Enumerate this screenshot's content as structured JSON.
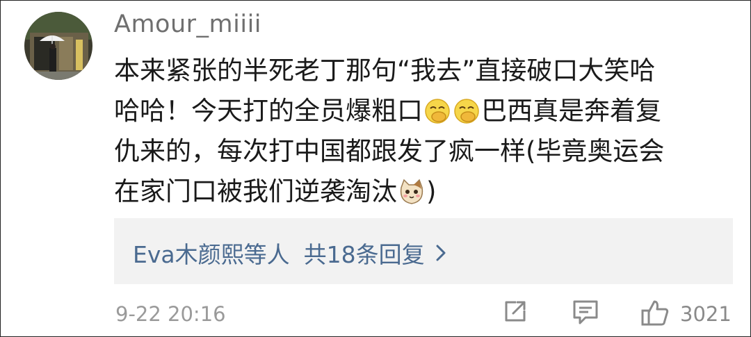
{
  "comment": {
    "username": "Amour_miiii",
    "text_lines": [
      "本来紧张的半死老丁那句“我去”直接破口大笑哈",
      "哈哈！今天打的全员爆粗口",
      "巴西真是奔着复",
      "仇来的，每次打中国都跟发了疯一样(毕竟奥运会",
      "在家门口被我们逆袭淘汰",
      ")"
    ],
    "emojis": [
      "laugh-cover-mouth-emoji",
      "laugh-cover-mouth-emoji",
      "cat-face-emoji"
    ],
    "replies": {
      "names": "Eva木颜熙等人",
      "count_text": "共18条回复"
    },
    "timestamp": "9-22 20:16",
    "like_count": "3021"
  },
  "icons": [
    "share-icon",
    "reply-comment-icon",
    "like-thumb-icon",
    "chevron-right-icon"
  ],
  "colors": {
    "username": "#6f6f6f",
    "text": "#1a1a1a",
    "link": "#4a6a90",
    "reply_bg": "#f2f2f2",
    "meta": "#9a9a9a"
  }
}
